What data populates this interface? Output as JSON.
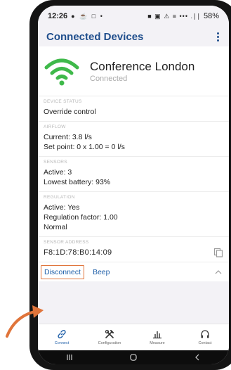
{
  "status_bar": {
    "time": "12:26",
    "left_icons": "● ☕ □ •",
    "right_icons": "■ ▣ ⚠ ≡ ••• .∣∣",
    "battery": "58%"
  },
  "app_bar": {
    "title": "Connected Devices"
  },
  "device": {
    "name": "Conference London",
    "status": "Connected"
  },
  "sections": {
    "device_status": {
      "label": "DEVICE STATUS",
      "lines": [
        "Override control"
      ]
    },
    "airflow": {
      "label": "AIRFLOW",
      "lines": [
        "Current: 3.8 l/s",
        "Set point: 0 x 1.00 = 0 l/s"
      ]
    },
    "sensors": {
      "label": "SENSORS",
      "lines": [
        "Active: 3",
        "Lowest battery: 93%"
      ]
    },
    "regulation": {
      "label": "REGULATION",
      "lines": [
        "Active: Yes",
        "Regulation factor: 1.00",
        "Normal"
      ]
    },
    "sensor_address": {
      "label": "SENSOR ADDRESS",
      "value": "F8:1D:78:B0:14:09"
    }
  },
  "actions": {
    "disconnect": "Disconnect",
    "beep": "Beep"
  },
  "bottom_nav": [
    {
      "label": "Connect",
      "icon": "link-icon",
      "active": true
    },
    {
      "label": "Configuration",
      "icon": "tools-icon",
      "active": false
    },
    {
      "label": "Measure",
      "icon": "bar-chart-icon",
      "active": false
    },
    {
      "label": "Contact",
      "icon": "headphones-icon",
      "active": false
    }
  ],
  "colors": {
    "accent": "#1f5fa8",
    "title": "#1f4e8c",
    "wifi": "#3fb94a",
    "highlight": "#e0743a"
  }
}
